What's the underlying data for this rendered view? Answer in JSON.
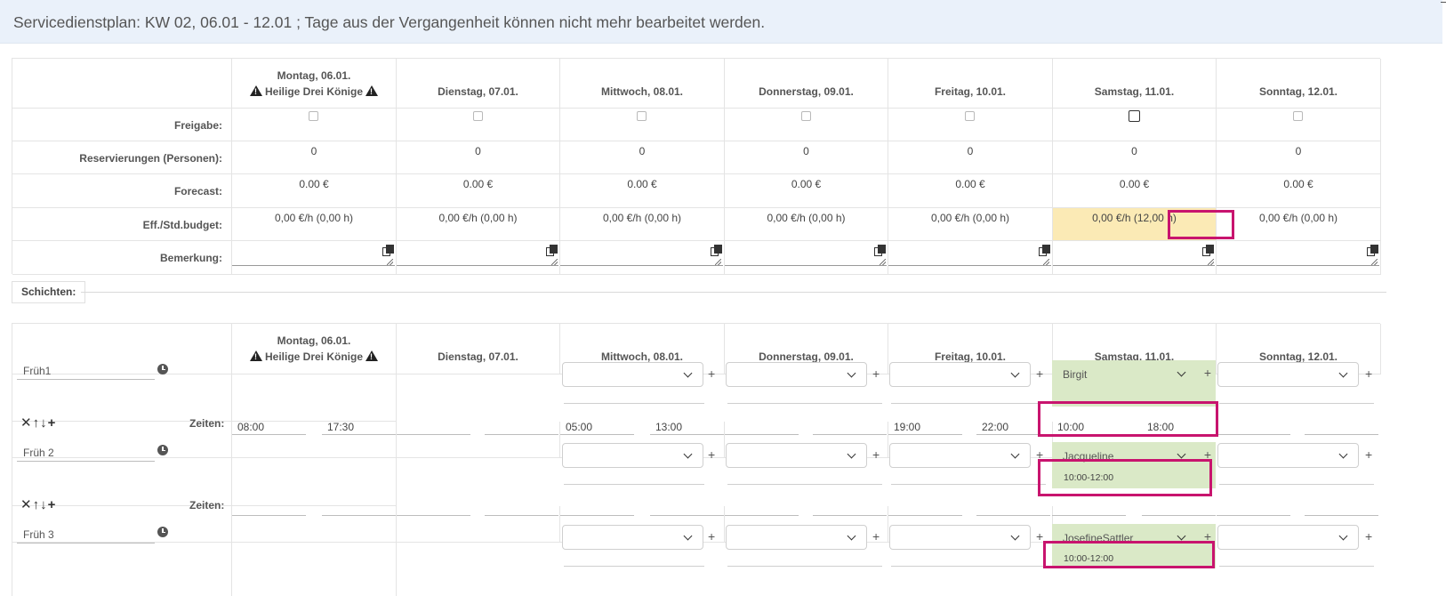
{
  "banner": {
    "text": "Servicedienstplan: KW 02, 06.01 - 12.01 ; Tage aus der Vergangenheit können nicht mehr bearbeitet werden."
  },
  "days": [
    {
      "label": "Montag, 06.01.",
      "holiday": "Heilige Drei Könige"
    },
    {
      "label": "Dienstag, 07.01."
    },
    {
      "label": "Mittwoch, 08.01."
    },
    {
      "label": "Donnerstag, 09.01."
    },
    {
      "label": "Freitag, 10.01."
    },
    {
      "label": "Samstag, 11.01."
    },
    {
      "label": "Sonntag, 12.01."
    }
  ],
  "summary": {
    "labels": {
      "freigabe": "Freigabe:",
      "reservierungen": "Reservierungen (Personen):",
      "forecast": "Forecast:",
      "eff": "Eff./Std.budget:",
      "bemerkung": "Bemerkung:"
    },
    "reservierungen": [
      "0",
      "0",
      "0",
      "0",
      "0",
      "0",
      "0"
    ],
    "forecast": [
      "0.00 €",
      "0.00 €",
      "0.00 €",
      "0.00 €",
      "0.00 €",
      "0.00 €",
      "0.00 €"
    ],
    "eff": [
      "0,00 €/h (0,00 h)",
      "0,00 €/h (0,00 h)",
      "0,00 €/h (0,00 h)",
      "0,00 €/h (0,00 h)",
      "0,00 €/h (0,00 h)",
      "0,00 €/h (12,00 h)",
      "0,00 €/h (0,00 h)"
    ],
    "highlight_color": "#fbeab5"
  },
  "section": {
    "label": "Schichten:"
  },
  "shifts": [
    {
      "name": "Früh1",
      "zeiten_label": "Zeiten:",
      "times": [
        "08:00",
        "17:30",
        "",
        "",
        "05:00",
        "13:00",
        "",
        "",
        "19:00",
        "22:00",
        "10:00",
        "18:00",
        "",
        ""
      ],
      "assigned": {
        "name": "Birgit",
        "time": ""
      }
    },
    {
      "name": "Früh 2",
      "zeiten_label": "Zeiten:",
      "times": [
        "",
        "",
        "",
        "",
        "",
        "",
        "",
        "",
        "",
        "",
        "",
        "",
        "",
        ""
      ],
      "assigned": {
        "name": "Jacqueline",
        "time": "10:00-12:00"
      }
    },
    {
      "name": "Früh 3",
      "assigned": {
        "name": "JosefineSattler",
        "time": "10:00-12:00"
      }
    }
  ],
  "controls": {
    "icons": "✕↑↓+"
  },
  "colors": {
    "accent_highlight": "#c8146e",
    "assigned_bg": "#dae9c7",
    "banner_bg": "#eaf1fa"
  }
}
